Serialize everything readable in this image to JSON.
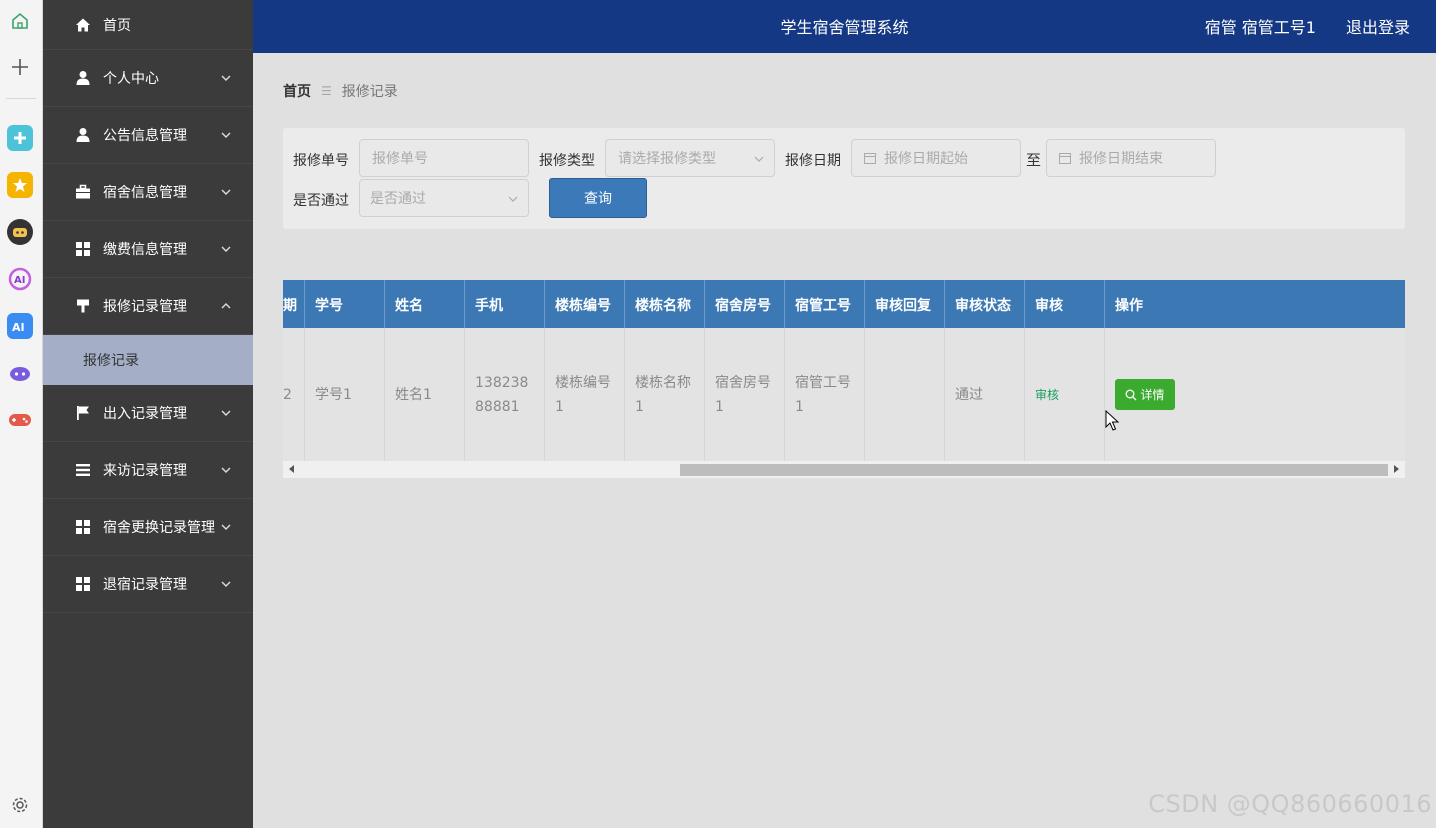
{
  "header": {
    "title": "学生宿舍管理系统",
    "user": "宿管 宿管工号1",
    "logout": "退出登录"
  },
  "sidebar": {
    "items": [
      {
        "label": "首页",
        "icon": "home-icon"
      },
      {
        "label": "个人中心",
        "icon": "user-icon"
      },
      {
        "label": "公告信息管理",
        "icon": "user-icon"
      },
      {
        "label": "宿舍信息管理",
        "icon": "briefcase-icon"
      },
      {
        "label": "缴费信息管理",
        "icon": "grid-icon"
      },
      {
        "label": "报修记录管理",
        "icon": "hammer-icon",
        "expanded": true
      },
      {
        "label": "出入记录管理",
        "icon": "flag-icon"
      },
      {
        "label": "来访记录管理",
        "icon": "list-icon"
      },
      {
        "label": "宿舍更换记录管理",
        "icon": "grid-icon"
      },
      {
        "label": "退宿记录管理",
        "icon": "grid-icon"
      }
    ],
    "sub_item": "报修记录"
  },
  "breadcrumb": {
    "home": "首页",
    "current": "报修记录"
  },
  "search": {
    "repair_no_label": "报修单号",
    "repair_no_placeholder": "报修单号",
    "repair_type_label": "报修类型",
    "repair_type_placeholder": "请选择报修类型",
    "repair_date_label": "报修日期",
    "date_start_placeholder": "报修日期起始",
    "date_to": "至",
    "date_end_placeholder": "报修日期结束",
    "approved_label": "是否通过",
    "approved_placeholder": "是否通过",
    "query_button": "查询"
  },
  "table": {
    "partial_header": "期",
    "columns": [
      "学号",
      "姓名",
      "手机",
      "楼栋编号",
      "楼栋名称",
      "宿舍房号",
      "宿管工号",
      "审核回复",
      "审核状态",
      "审核",
      "操作"
    ],
    "rows": [
      {
        "partial": "2",
        "student_no": "学号1",
        "name": "姓名1",
        "phone": "13823888881",
        "building_no": "楼栋编号1",
        "building_name": "楼栋名称1",
        "room_no": "宿舍房号1",
        "manager_no": "宿管工号1",
        "reply": "",
        "status": "通过",
        "audit_link": "审核",
        "detail_button": "详情"
      }
    ]
  },
  "watermark": "CSDN @QQ860660016",
  "colors": {
    "header": "#143883",
    "sidebar": "#3b3b3b",
    "table_header": "#3b78b4",
    "detail_button": "#3aab2e",
    "query_button": "#3c79b8"
  }
}
